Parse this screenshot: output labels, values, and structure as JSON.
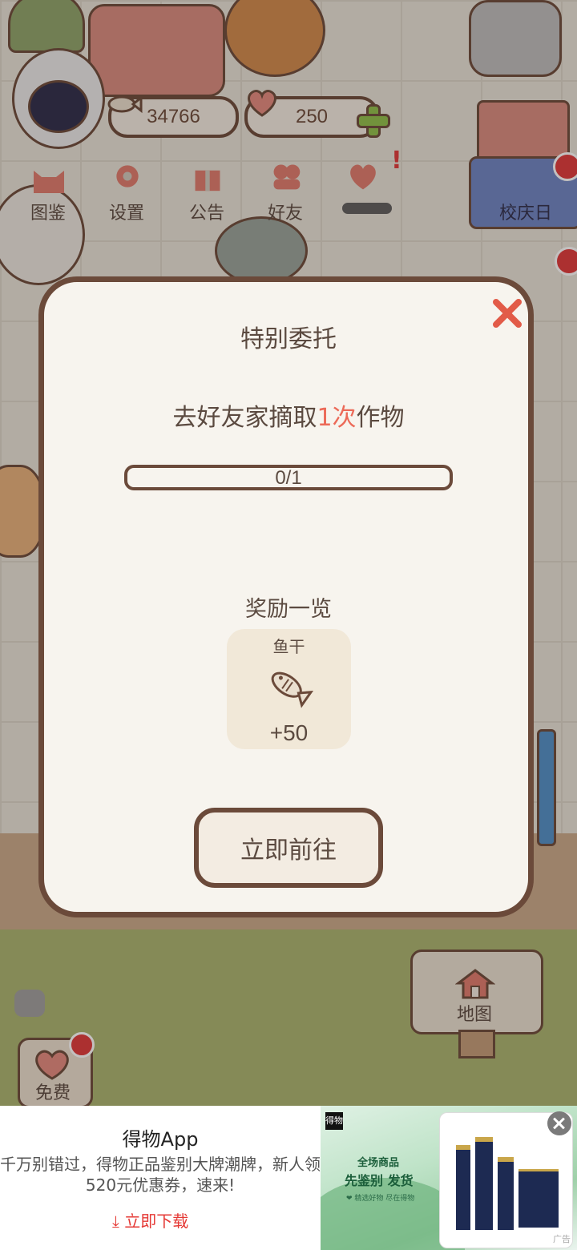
{
  "hud": {
    "fish_count": "34766",
    "heart_count": "250",
    "menu": [
      {
        "label": "图鉴",
        "icon": "cat-face-icon"
      },
      {
        "label": "设置",
        "icon": "gear-icon"
      },
      {
        "label": "公告",
        "icon": "gift-icon"
      },
      {
        "label": "好友",
        "icon": "friends-icon"
      },
      {
        "label": "",
        "icon": "heart-icon"
      }
    ],
    "event_label": "校庆日",
    "map_label": "地图",
    "free_label": "免费"
  },
  "modal": {
    "title": "特别委托",
    "task_prefix": "去好友家摘取",
    "task_highlight": "1次",
    "task_suffix": "作物",
    "progress_text": "0/1",
    "progress_fraction": 0,
    "reward_heading": "奖励一览",
    "reward": {
      "name": "鱼干",
      "amount": "+50",
      "icon": "fish-icon"
    },
    "go_button": "立即前往"
  },
  "ad": {
    "title": "得物App",
    "description": "千万别错过，得物正品鉴别大牌潮牌，新人领520元优惠券，速来!",
    "download": "立即下载",
    "logo_text": "得物",
    "tag1": "全场商品",
    "tag2": "先鉴别 发货",
    "tag3": "❤ 精选好物 尽在得物",
    "mark": "广告"
  },
  "colors": {
    "outline": "#6b4a3a",
    "highlight": "#ec6a58",
    "close": "#e25b48",
    "panel": "#f7f4ee",
    "ad_download": "#e53935"
  }
}
